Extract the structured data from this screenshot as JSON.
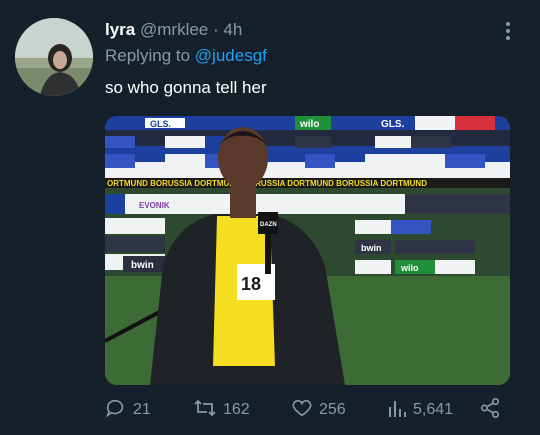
{
  "tweet": {
    "display_name": "lyra",
    "handle": "@mrklee",
    "separator": "·",
    "time": "4h",
    "replying_prefix": "Replying to",
    "replying_to": "@judesgf",
    "text": "so who gonna tell her"
  },
  "media": {
    "boards": {
      "brand_top_left": "GLS.",
      "brand_wilo": "wilo",
      "brand_gls": "GLS.",
      "brand_evonik": "EVONIK",
      "brand_bwin": "bwin",
      "brand_bwin_right": "bwin",
      "brand_wilo_bottom": "wilo",
      "stadium_banner": "ORTMUND  BORUSSIA DORTMUND  BORUSSIA DORTMUND  BORUSSIA DORTMUND",
      "mic_flag": "DAZN",
      "shirt_number": "18"
    }
  },
  "actions": {
    "replies": "21",
    "retweets": "162",
    "likes": "256",
    "views": "5,641"
  },
  "icons": {
    "reply": "reply-icon",
    "retweet": "retweet-icon",
    "like": "heart-icon",
    "views": "analytics-icon",
    "share": "share-icon",
    "more": "more-vertical-icon"
  },
  "colors": {
    "background": "#15202b",
    "text": "#ffffff",
    "muted": "#8899a6",
    "link": "#1da1f2",
    "jersey": "#f5dd20"
  }
}
